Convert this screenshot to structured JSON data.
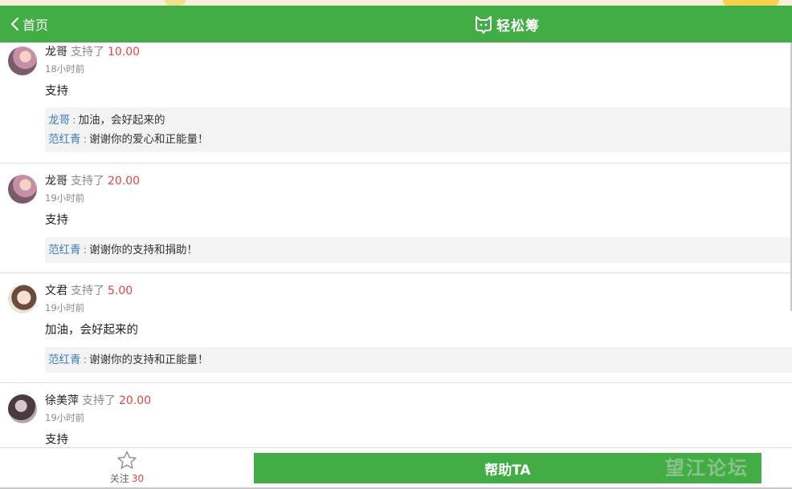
{
  "header": {
    "back_label": "首页",
    "brand_title": "轻松筹",
    "brand_icon": "cat-logo-icon",
    "color": "#42ad44"
  },
  "comments": [
    {
      "name": "龙哥",
      "action": "支持了",
      "amount": "10.00",
      "time": "18小时前",
      "message": "支持",
      "replies": [
        {
          "who": "龙哥",
          "text": "加油，会好起来的"
        },
        {
          "who": "范红青",
          "text": "谢谢你的爱心和正能量！"
        }
      ]
    },
    {
      "name": "龙哥",
      "action": "支持了",
      "amount": "20.00",
      "time": "19小时前",
      "message": "支持",
      "replies": [
        {
          "who": "范红青",
          "text": "谢谢你的支持和捐助！"
        }
      ]
    },
    {
      "name": "文君",
      "action": "支持了",
      "amount": "5.00",
      "time": "19小时前",
      "message": "加油，会好起来的",
      "replies": [
        {
          "who": "范红青",
          "text": "谢谢你的支持和正能量！"
        }
      ]
    },
    {
      "name": "徐美萍",
      "action": "支持了",
      "amount": "20.00",
      "time": "19小时前",
      "message": "支持",
      "replies": []
    }
  ],
  "footer": {
    "follow_label": "关注",
    "follow_count": "30",
    "help_label": "帮助TA",
    "watermark": "望江论坛"
  },
  "colors": {
    "accent": "#42ad44",
    "amount": "#e2453b",
    "reply_name": "#3b7cc0"
  }
}
